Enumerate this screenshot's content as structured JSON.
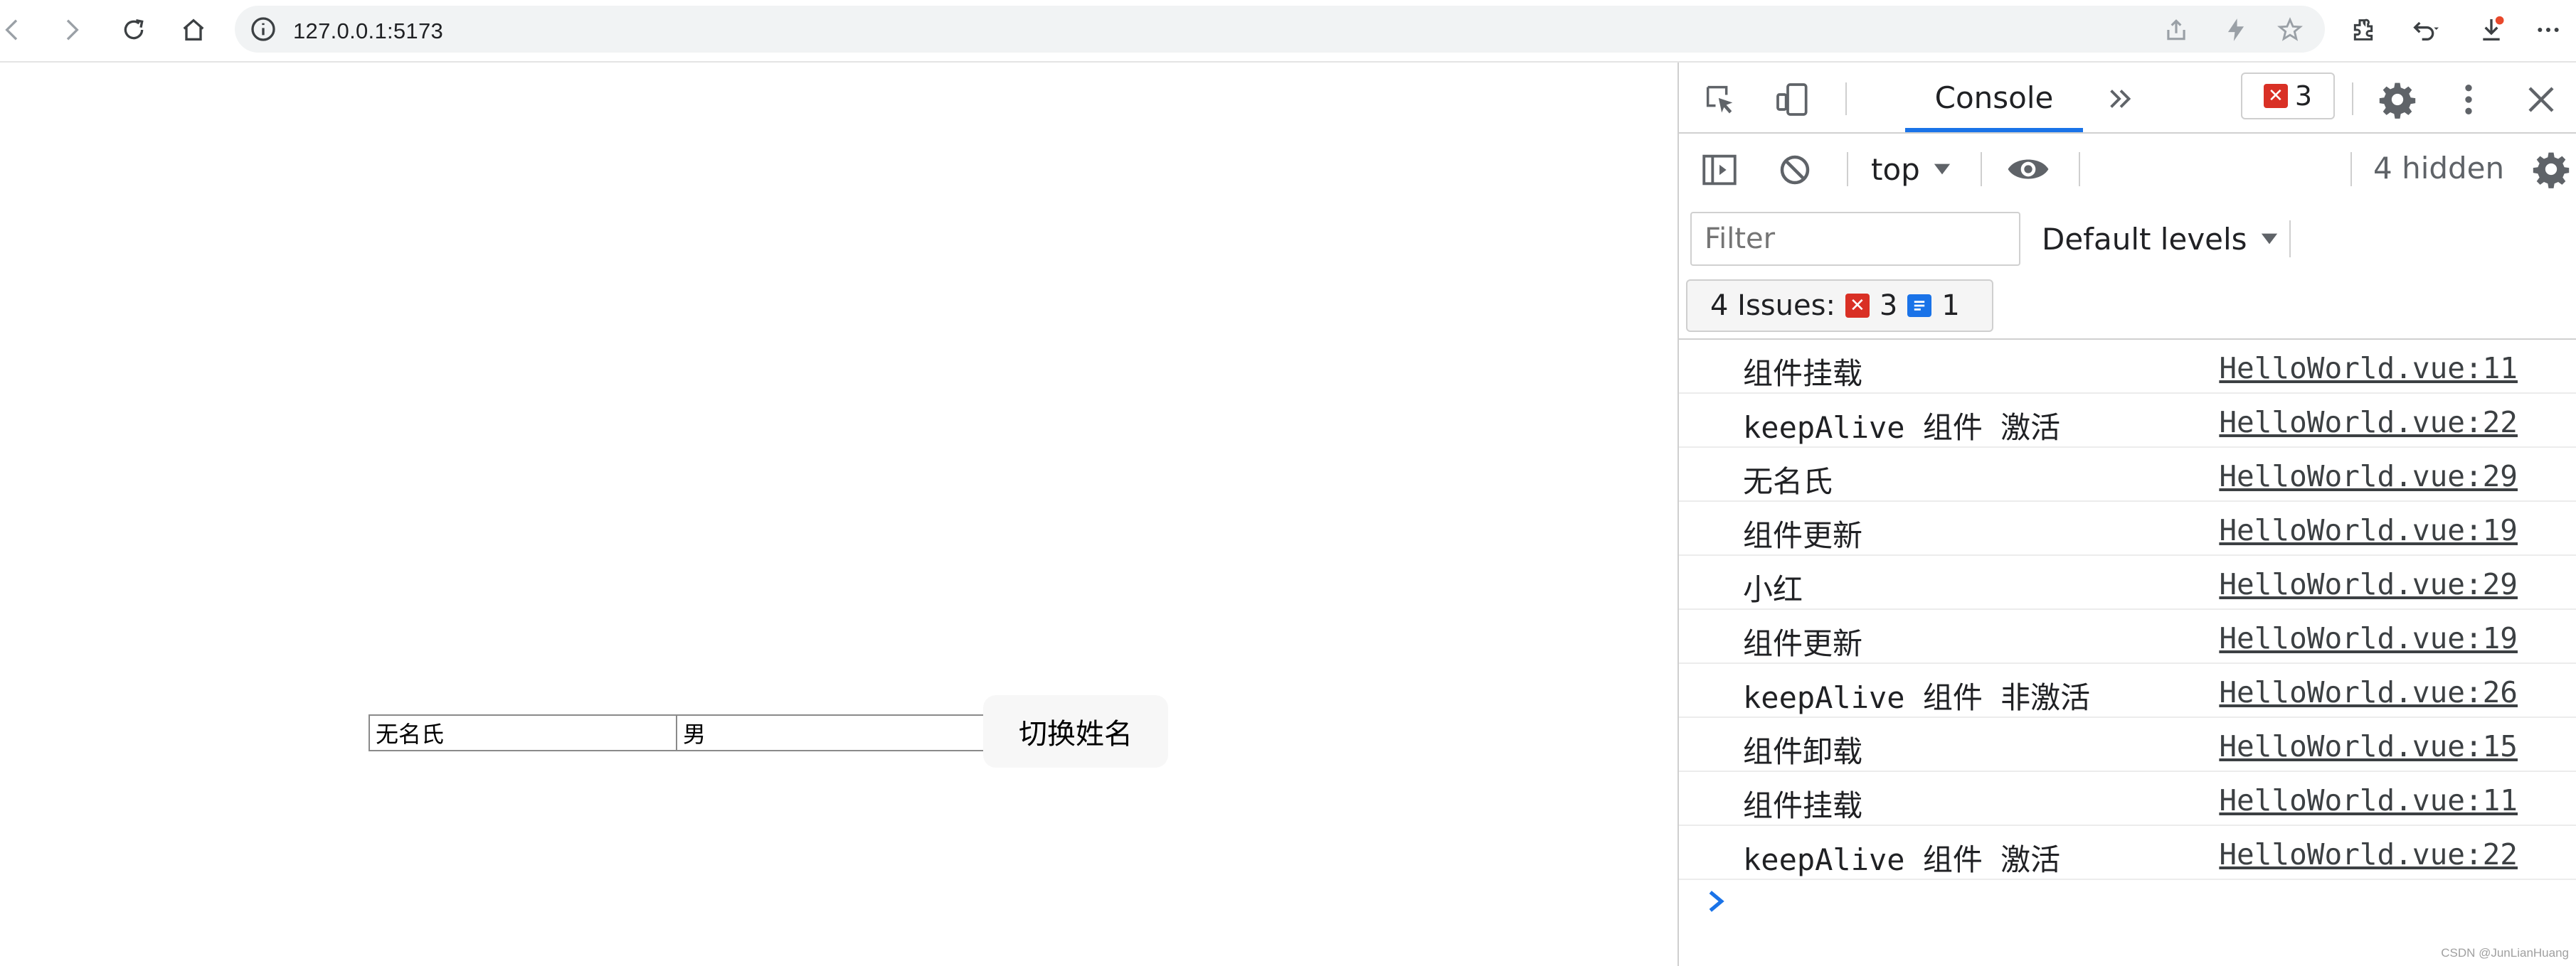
{
  "browser": {
    "url": "127.0.0.1:5173"
  },
  "page": {
    "name_input_value": "无名氏",
    "gender_input_value": "男",
    "switch_button_label": "切换姓名"
  },
  "devtools": {
    "tab_console_label": "Console",
    "error_count": "3",
    "context_label": "top",
    "hidden_label": "4 hidden",
    "filter_placeholder": "Filter",
    "levels_label": "Default levels",
    "issues": {
      "label": "4 Issues:",
      "error_count": "3",
      "info_count": "1"
    },
    "logs": [
      {
        "message": "组件挂载",
        "source": "HelloWorld.vue:11"
      },
      {
        "message": "keepAlive 组件 激活",
        "source": "HelloWorld.vue:22"
      },
      {
        "message": "无名氏",
        "source": "HelloWorld.vue:29"
      },
      {
        "message": "组件更新",
        "source": "HelloWorld.vue:19"
      },
      {
        "message": "小红",
        "source": "HelloWorld.vue:29"
      },
      {
        "message": "组件更新",
        "source": "HelloWorld.vue:19"
      },
      {
        "message": "keepAlive 组件 非激活",
        "source": "HelloWorld.vue:26"
      },
      {
        "message": "组件卸载",
        "source": "HelloWorld.vue:15"
      },
      {
        "message": "组件挂载",
        "source": "HelloWorld.vue:11"
      },
      {
        "message": "keepAlive 组件 激活",
        "source": "HelloWorld.vue:22"
      }
    ]
  },
  "watermark": "CSDN @JunLianHuang",
  "colors": {
    "accent": "#1a73e8",
    "error": "#d93025",
    "notification_dot": "#e8482b"
  }
}
